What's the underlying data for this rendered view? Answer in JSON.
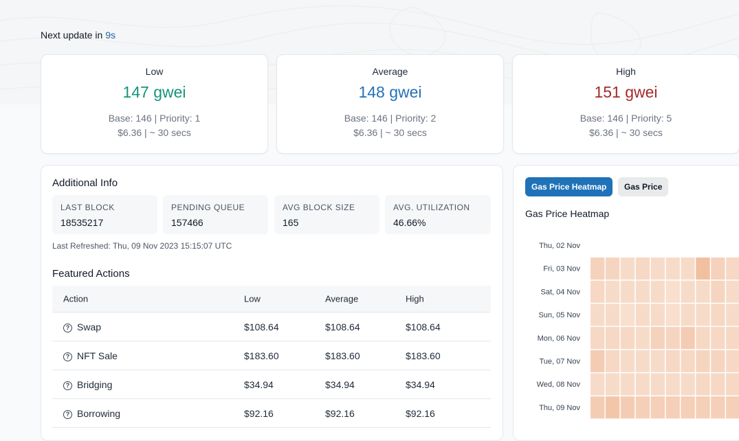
{
  "header": {
    "next_update_label": "Next update in",
    "next_update_seconds": "9s"
  },
  "price_cards": [
    {
      "label": "Low",
      "value": "147 gwei",
      "detail": "Base: 146 | Priority: 1",
      "cost": "$6.36 | ~ 30 secs",
      "color": "#16937a"
    },
    {
      "label": "Average",
      "value": "148 gwei",
      "detail": "Base: 146 | Priority: 2",
      "cost": "$6.36 | ~ 30 secs",
      "color": "#2471b5"
    },
    {
      "label": "High",
      "value": "151 gwei",
      "detail": "Base: 146 | Priority: 5",
      "cost": "$6.36 | ~ 30 secs",
      "color": "#a52a2a"
    }
  ],
  "additional_info": {
    "title": "Additional Info",
    "stats": [
      {
        "label": "LAST BLOCK",
        "value": "18535217"
      },
      {
        "label": "PENDING QUEUE",
        "value": "157466"
      },
      {
        "label": "AVG BLOCK SIZE",
        "value": "165"
      },
      {
        "label": "AVG. UTILIZATION",
        "value": "46.66%"
      }
    ],
    "last_refreshed": "Last Refreshed: Thu, 09 Nov 2023 15:15:07 UTC"
  },
  "featured_actions": {
    "title": "Featured Actions",
    "columns": [
      "Action",
      "Low",
      "Average",
      "High"
    ],
    "rows": [
      {
        "action": "Swap",
        "low": "$108.64",
        "average": "$108.64",
        "high": "$108.64"
      },
      {
        "action": "NFT Sale",
        "low": "$183.60",
        "average": "$183.60",
        "high": "$183.60"
      },
      {
        "action": "Bridging",
        "low": "$34.94",
        "average": "$34.94",
        "high": "$34.94"
      },
      {
        "action": "Borrowing",
        "low": "$92.16",
        "average": "$92.16",
        "high": "$92.16"
      }
    ]
  },
  "heatmap": {
    "tabs": [
      "Gas Price Heatmap",
      "Gas Price"
    ],
    "active_tab": "Gas Price Heatmap",
    "title": "Gas Price Heatmap",
    "days": [
      "Thu, 02 Nov",
      "Fri, 03 Nov",
      "Sat, 04 Nov",
      "Sun, 05 Nov",
      "Mon, 06 Nov",
      "Tue, 07 Nov",
      "Wed, 08 Nov",
      "Thu, 09 Nov"
    ],
    "intensity_rows": [
      null,
      [
        0.45,
        0.4,
        0.3,
        0.35,
        0.3,
        0.3,
        0.3,
        0.75,
        0.45,
        0.35
      ],
      [
        0.35,
        0.3,
        0.3,
        0.3,
        0.3,
        0.25,
        0.3,
        0.3,
        0.4,
        0.3
      ],
      [
        0.3,
        0.3,
        0.25,
        0.3,
        0.3,
        0.25,
        0.3,
        0.3,
        0.35,
        0.3
      ],
      [
        0.35,
        0.35,
        0.35,
        0.3,
        0.45,
        0.4,
        0.55,
        0.35,
        0.35,
        0.35
      ],
      [
        0.55,
        0.35,
        0.3,
        0.3,
        0.3,
        0.35,
        0.35,
        0.4,
        0.4,
        0.35
      ],
      [
        0.3,
        0.3,
        0.3,
        0.3,
        0.3,
        0.3,
        0.3,
        0.35,
        0.35,
        0.35
      ],
      [
        0.55,
        0.65,
        0.55,
        0.5,
        0.5,
        0.5,
        0.5,
        0.5,
        0.5,
        0.5
      ]
    ],
    "colors": {
      "low": "#fbeee4",
      "high": "#eeb08a"
    }
  }
}
